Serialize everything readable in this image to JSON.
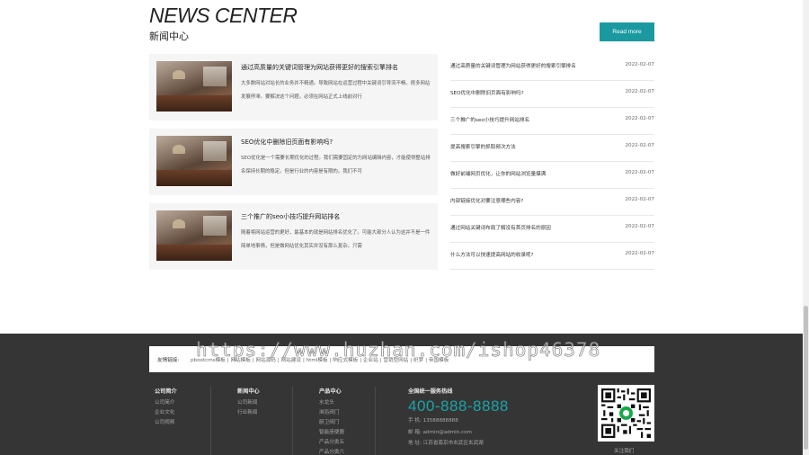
{
  "header": {
    "title_en": "NEWS CENTER",
    "title_cn": "新闻中心",
    "read_more": "Read more"
  },
  "featured": [
    {
      "title": "通过高质量的关键词管理为网站获得更好的搜索引擎排名",
      "desc": "大多数网站对站长的业务并不精通。导致网站在运营过程中关键词引导流不畅。很多网站发展停滞。要解决这个问题，必须在网站正式上线前对行"
    },
    {
      "title": "SEO优化中删除旧页面有影响吗?",
      "desc": "SEO优化是一个需要长期优化的过程。我们需要固定的为网站编辑内容，才能使得整站排名保持长期的稳定。但是行业的内容是有限的。我们不可"
    },
    {
      "title": "三个推广的seo小技巧提升网站排名",
      "desc": "随着将网站运营的更好，最基本的就是网站排名优化了。可能大部分人认为这并不是一件简单地事情，但是做网站优化其实并没有那么复杂。只需"
    }
  ],
  "news_list": [
    {
      "title": "通过高质量的关键词管理为网站获得更好的搜索引擎排名",
      "date": "2022-02-07"
    },
    {
      "title": "SEO优化中删除旧页面有影响吗?",
      "date": "2022-02-07"
    },
    {
      "title": "三个推广的seo小技巧提升网站排名",
      "date": "2022-02-07"
    },
    {
      "title": "提高搜索引擎的抓取频次方法",
      "date": "2022-02-07"
    },
    {
      "title": "做好前端网页优化，让你的网站浏览量爆满",
      "date": "2022-02-07"
    },
    {
      "title": "内部链接优化对要注意哪些内容?",
      "date": "2022-02-07"
    },
    {
      "title": "通过网站关键词布局了解没有首页排名的原因",
      "date": "2022-02-07"
    },
    {
      "title": "什么方法可以快速提高网站的收录呢?",
      "date": "2022-02-07"
    }
  ],
  "friend_links": {
    "label": "友情链接:",
    "items": [
      "pbootcms模板",
      "网站模板",
      "网站源码",
      "网站建设",
      "html模板",
      "响应式模板",
      "企业站",
      "营销型网站",
      "织梦",
      "帝国模板"
    ]
  },
  "footer": {
    "col1": {
      "title": "公司简介",
      "items": [
        "公司简介",
        "企业文化",
        "公司视频"
      ]
    },
    "col2": {
      "title": "新闻中心",
      "items": [
        "公司新闻",
        "行业新闻"
      ]
    },
    "col3": {
      "title": "产品中心",
      "items": [
        "水龙头",
        "淋浴阀门",
        "厨卫阀门",
        "智能座便器",
        "产品分类五",
        "产品分类六"
      ]
    },
    "contact": {
      "title": "全国统一服务热线",
      "hotline": "400-888-8888",
      "phone": "手  机:  13588888888",
      "email": "邮  箱:  admin@admin.com",
      "address": "地  址:  江苏省南京市玄武区玄武湖"
    },
    "follow": "关注我们"
  },
  "watermark": "https://www.huzhan.com/ishop46378"
}
